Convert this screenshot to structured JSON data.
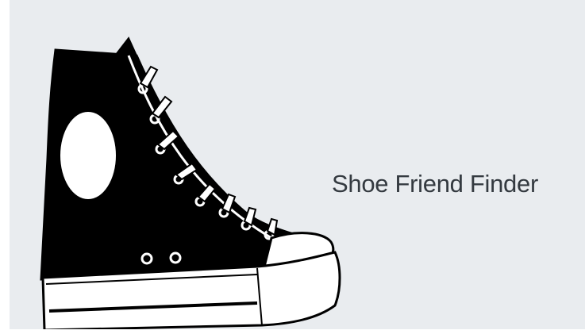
{
  "hero": {
    "title": "Shoe Friend Finder",
    "image": {
      "icon": "high-top-sneaker-icon"
    }
  },
  "colors": {
    "background": "#e9ecef",
    "title_text": "#343a40",
    "shoe_body": "#000000",
    "shoe_sole": "#ffffff"
  }
}
